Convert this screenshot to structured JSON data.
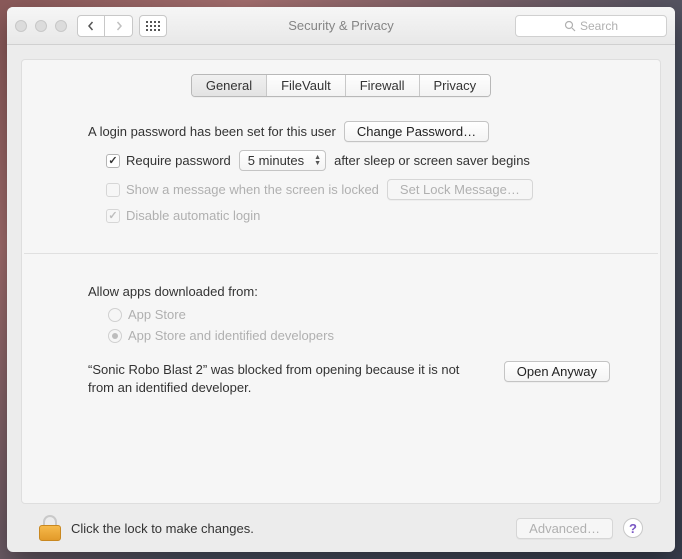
{
  "window": {
    "title": "Security & Privacy",
    "search_placeholder": "Search"
  },
  "tabs": [
    "General",
    "FileVault",
    "Firewall",
    "Privacy"
  ],
  "general": {
    "pw_set_text": "A login password has been set for this user",
    "change_pw_label": "Change Password…",
    "require_pw_label": "Require password",
    "require_pw_delay": "5 minutes",
    "require_pw_suffix": "after sleep or screen saver begins",
    "show_message_label": "Show a message when the screen is locked",
    "set_lock_msg_label": "Set Lock Message…",
    "disable_auto_login_label": "Disable automatic login"
  },
  "apps": {
    "header": "Allow apps downloaded from:",
    "opt_appstore": "App Store",
    "opt_identified": "App Store and identified developers",
    "blocked_text": "“Sonic Robo Blast 2” was blocked from opening because it is not from an identified developer.",
    "open_anyway_label": "Open Anyway"
  },
  "footer": {
    "lock_text": "Click the lock to make changes.",
    "advanced_label": "Advanced…"
  }
}
